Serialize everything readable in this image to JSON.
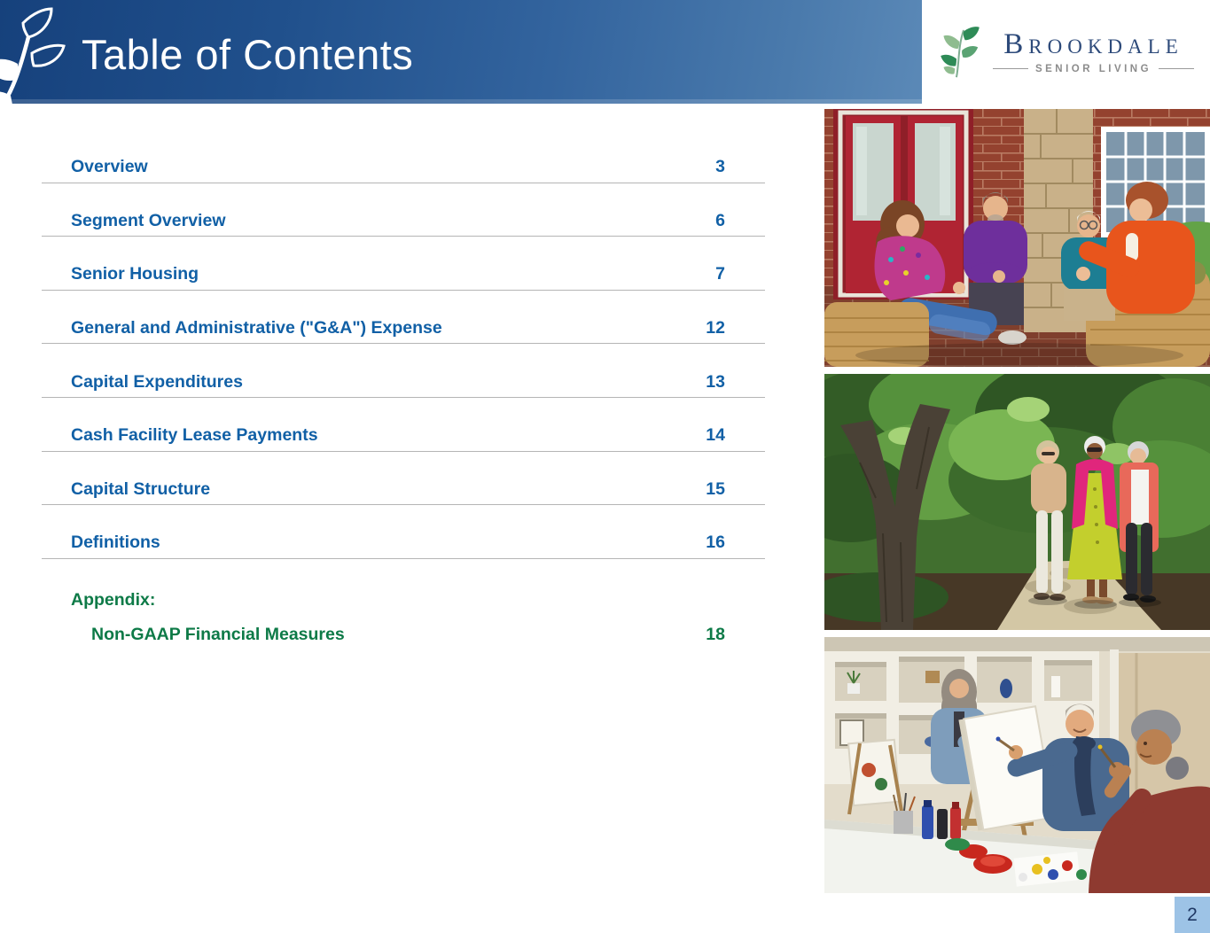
{
  "header": {
    "title": "Table of Contents",
    "logo": {
      "brand": "Brookdale",
      "tagline": "SENIOR LIVING"
    }
  },
  "toc": {
    "entries": [
      {
        "label": "Overview",
        "page": "3"
      },
      {
        "label": "Segment Overview",
        "page": "6"
      },
      {
        "label": "Senior Housing",
        "page": "7"
      },
      {
        "label": "General and Administrative (\"G&A\") Expense",
        "page": "12"
      },
      {
        "label": "Capital Expenditures",
        "page": "13"
      },
      {
        "label": "Cash Facility Lease Payments",
        "page": "14"
      },
      {
        "label": "Capital Structure",
        "page": "15"
      },
      {
        "label": "Definitions",
        "page": "16"
      }
    ],
    "appendix": {
      "label": "Appendix:",
      "items": [
        {
          "label": "Non-GAAP Financial Measures",
          "page": "18"
        }
      ]
    }
  },
  "photos": [
    {
      "alt": "Four seniors chatting together on a patio with wicker furniture, red doors and brick wall"
    },
    {
      "alt": "Three senior women walking and talking on a sunny path beneath trees"
    },
    {
      "alt": "Seniors painting at an easel during an art class with an instructor"
    }
  ],
  "footer": {
    "page_number": "2"
  },
  "colors": {
    "toc_text": "#1160a6",
    "appendix_text": "#0d7a47",
    "rule": "#b5b5b5",
    "logo_navy": "#2d4a7a",
    "logo_green_dark": "#2e8b57",
    "logo_green_light": "#8fbc8f",
    "page_badge_bg": "#9dc3e6",
    "page_badge_text": "#1f3864",
    "header_gradient_left": "#16417c",
    "header_gradient_right": "#5b89b7"
  }
}
